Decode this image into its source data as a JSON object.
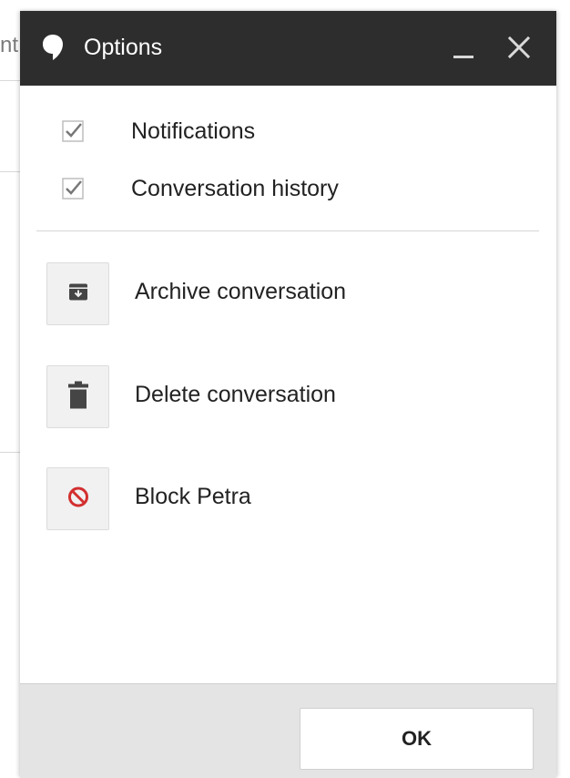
{
  "background": {
    "partial_text": "nt"
  },
  "dialog": {
    "title": "Options",
    "icons": {
      "title_icon": "hangouts-bubble-icon",
      "minimize": "minimize-icon",
      "close": "close-icon"
    },
    "checkboxes": [
      {
        "label": "Notifications",
        "checked": true
      },
      {
        "label": "Conversation history",
        "checked": true
      }
    ],
    "actions": [
      {
        "label": "Archive conversation",
        "icon": "archive-icon"
      },
      {
        "label": "Delete conversation",
        "icon": "trash-icon"
      },
      {
        "label": "Block Petra",
        "icon": "block-icon",
        "icon_color": "#d32f2f"
      }
    ],
    "ok_label": "OK"
  },
  "colors": {
    "titlebar": "#2d2d2d",
    "footer": "#e4e4e4",
    "block_red": "#d32f2f"
  }
}
